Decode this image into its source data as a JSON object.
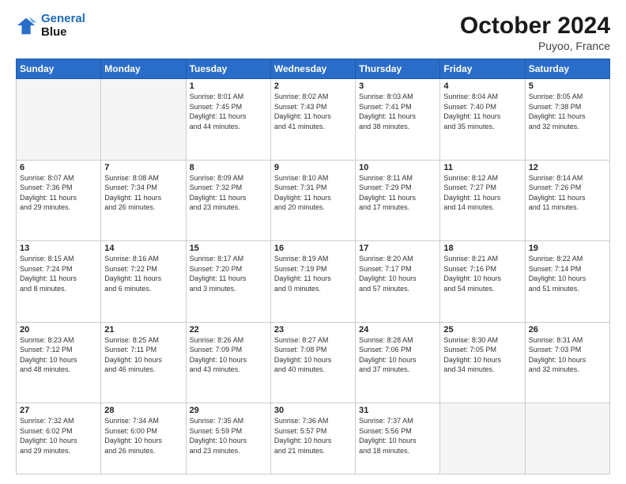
{
  "header": {
    "logo_line1": "General",
    "logo_line2": "Blue",
    "month": "October 2024",
    "location": "Puyoo, France"
  },
  "weekdays": [
    "Sunday",
    "Monday",
    "Tuesday",
    "Wednesday",
    "Thursday",
    "Friday",
    "Saturday"
  ],
  "weeks": [
    [
      {
        "day": "",
        "info": ""
      },
      {
        "day": "",
        "info": ""
      },
      {
        "day": "1",
        "info": "Sunrise: 8:01 AM\nSunset: 7:45 PM\nDaylight: 11 hours\nand 44 minutes."
      },
      {
        "day": "2",
        "info": "Sunrise: 8:02 AM\nSunset: 7:43 PM\nDaylight: 11 hours\nand 41 minutes."
      },
      {
        "day": "3",
        "info": "Sunrise: 8:03 AM\nSunset: 7:41 PM\nDaylight: 11 hours\nand 38 minutes."
      },
      {
        "day": "4",
        "info": "Sunrise: 8:04 AM\nSunset: 7:40 PM\nDaylight: 11 hours\nand 35 minutes."
      },
      {
        "day": "5",
        "info": "Sunrise: 8:05 AM\nSunset: 7:38 PM\nDaylight: 11 hours\nand 32 minutes."
      }
    ],
    [
      {
        "day": "6",
        "info": "Sunrise: 8:07 AM\nSunset: 7:36 PM\nDaylight: 11 hours\nand 29 minutes."
      },
      {
        "day": "7",
        "info": "Sunrise: 8:08 AM\nSunset: 7:34 PM\nDaylight: 11 hours\nand 26 minutes."
      },
      {
        "day": "8",
        "info": "Sunrise: 8:09 AM\nSunset: 7:32 PM\nDaylight: 11 hours\nand 23 minutes."
      },
      {
        "day": "9",
        "info": "Sunrise: 8:10 AM\nSunset: 7:31 PM\nDaylight: 11 hours\nand 20 minutes."
      },
      {
        "day": "10",
        "info": "Sunrise: 8:11 AM\nSunset: 7:29 PM\nDaylight: 11 hours\nand 17 minutes."
      },
      {
        "day": "11",
        "info": "Sunrise: 8:12 AM\nSunset: 7:27 PM\nDaylight: 11 hours\nand 14 minutes."
      },
      {
        "day": "12",
        "info": "Sunrise: 8:14 AM\nSunset: 7:26 PM\nDaylight: 11 hours\nand 11 minutes."
      }
    ],
    [
      {
        "day": "13",
        "info": "Sunrise: 8:15 AM\nSunset: 7:24 PM\nDaylight: 11 hours\nand 8 minutes."
      },
      {
        "day": "14",
        "info": "Sunrise: 8:16 AM\nSunset: 7:22 PM\nDaylight: 11 hours\nand 6 minutes."
      },
      {
        "day": "15",
        "info": "Sunrise: 8:17 AM\nSunset: 7:20 PM\nDaylight: 11 hours\nand 3 minutes."
      },
      {
        "day": "16",
        "info": "Sunrise: 8:19 AM\nSunset: 7:19 PM\nDaylight: 11 hours\nand 0 minutes."
      },
      {
        "day": "17",
        "info": "Sunrise: 8:20 AM\nSunset: 7:17 PM\nDaylight: 10 hours\nand 57 minutes."
      },
      {
        "day": "18",
        "info": "Sunrise: 8:21 AM\nSunset: 7:16 PM\nDaylight: 10 hours\nand 54 minutes."
      },
      {
        "day": "19",
        "info": "Sunrise: 8:22 AM\nSunset: 7:14 PM\nDaylight: 10 hours\nand 51 minutes."
      }
    ],
    [
      {
        "day": "20",
        "info": "Sunrise: 8:23 AM\nSunset: 7:12 PM\nDaylight: 10 hours\nand 48 minutes."
      },
      {
        "day": "21",
        "info": "Sunrise: 8:25 AM\nSunset: 7:11 PM\nDaylight: 10 hours\nand 46 minutes."
      },
      {
        "day": "22",
        "info": "Sunrise: 8:26 AM\nSunset: 7:09 PM\nDaylight: 10 hours\nand 43 minutes."
      },
      {
        "day": "23",
        "info": "Sunrise: 8:27 AM\nSunset: 7:08 PM\nDaylight: 10 hours\nand 40 minutes."
      },
      {
        "day": "24",
        "info": "Sunrise: 8:28 AM\nSunset: 7:06 PM\nDaylight: 10 hours\nand 37 minutes."
      },
      {
        "day": "25",
        "info": "Sunrise: 8:30 AM\nSunset: 7:05 PM\nDaylight: 10 hours\nand 34 minutes."
      },
      {
        "day": "26",
        "info": "Sunrise: 8:31 AM\nSunset: 7:03 PM\nDaylight: 10 hours\nand 32 minutes."
      }
    ],
    [
      {
        "day": "27",
        "info": "Sunrise: 7:32 AM\nSunset: 6:02 PM\nDaylight: 10 hours\nand 29 minutes."
      },
      {
        "day": "28",
        "info": "Sunrise: 7:34 AM\nSunset: 6:00 PM\nDaylight: 10 hours\nand 26 minutes."
      },
      {
        "day": "29",
        "info": "Sunrise: 7:35 AM\nSunset: 5:59 PM\nDaylight: 10 hours\nand 23 minutes."
      },
      {
        "day": "30",
        "info": "Sunrise: 7:36 AM\nSunset: 5:57 PM\nDaylight: 10 hours\nand 21 minutes."
      },
      {
        "day": "31",
        "info": "Sunrise: 7:37 AM\nSunset: 5:56 PM\nDaylight: 10 hours\nand 18 minutes."
      },
      {
        "day": "",
        "info": ""
      },
      {
        "day": "",
        "info": ""
      }
    ]
  ]
}
